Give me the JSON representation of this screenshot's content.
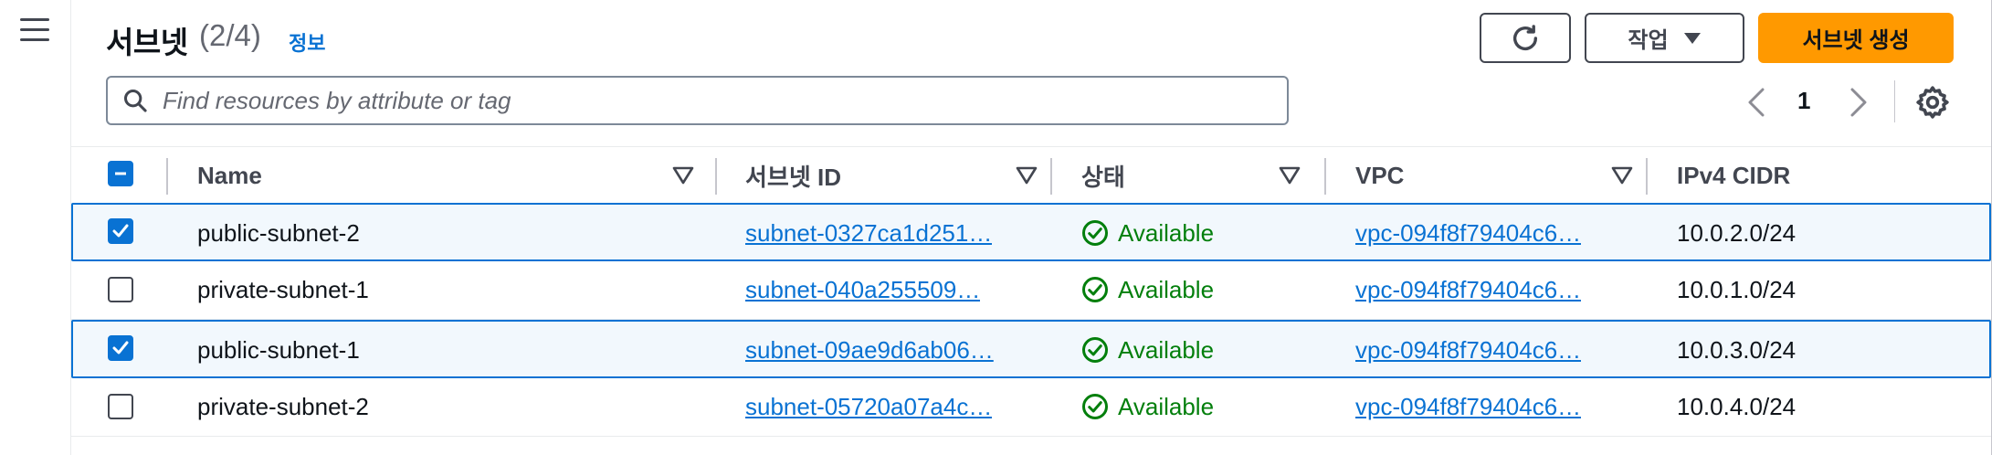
{
  "header": {
    "title": "서브넷",
    "count": "(2/4)",
    "info_link": "정보",
    "actions_label": "작업",
    "create_label": "서브넷 생성"
  },
  "search": {
    "placeholder": "Find resources by attribute or tag"
  },
  "pagination": {
    "current_page": "1"
  },
  "table": {
    "columns": [
      "Name",
      "서브넷 ID",
      "상태",
      "VPC",
      "IPv4 CIDR"
    ],
    "rows": [
      {
        "selected": true,
        "name": "public-subnet-2",
        "subnet_id": "subnet-0327ca1d251…",
        "status": "Available",
        "vpc": "vpc-094f8f79404c6…",
        "cidr": "10.0.2.0/24"
      },
      {
        "selected": false,
        "name": "private-subnet-1",
        "subnet_id": "subnet-040a255509…",
        "status": "Available",
        "vpc": "vpc-094f8f79404c6…",
        "cidr": "10.0.1.0/24"
      },
      {
        "selected": true,
        "name": "public-subnet-1",
        "subnet_id": "subnet-09ae9d6ab06…",
        "status": "Available",
        "vpc": "vpc-094f8f79404c6…",
        "cidr": "10.0.3.0/24"
      },
      {
        "selected": false,
        "name": "private-subnet-2",
        "subnet_id": "subnet-05720a07a4c…",
        "status": "Available",
        "vpc": "vpc-094f8f79404c6…",
        "cidr": "10.0.4.0/24"
      }
    ]
  },
  "colors": {
    "accent": "#0972d3",
    "primary_button": "#ff9900",
    "status_available": "#037f0c",
    "selected_row_bg": "#f2f8fd"
  },
  "icons": [
    "menu-icon",
    "refresh-icon",
    "caret-down-icon",
    "search-icon",
    "chevron-left-icon",
    "chevron-right-icon",
    "gear-icon",
    "sort-icon",
    "status-check-icon"
  ]
}
